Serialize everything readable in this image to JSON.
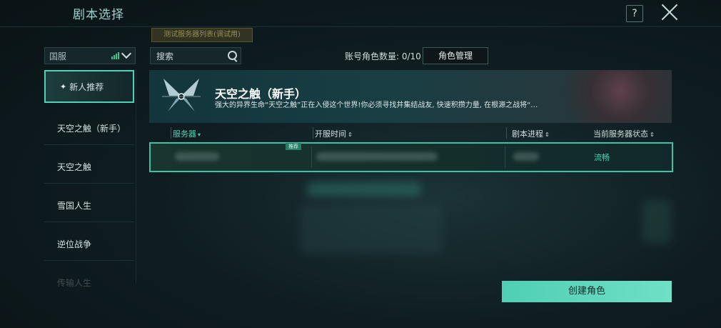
{
  "header": {
    "title": "剧本选择",
    "help_label": "?"
  },
  "test_badge": "测试服务器列表(调试用)",
  "region": {
    "label": "国服"
  },
  "search": {
    "placeholder": "搜索"
  },
  "account": {
    "label": "账号角色数量: 0/10",
    "role_manage_label": "角色管理"
  },
  "sidebar": {
    "items": [
      {
        "label": "新人推荐",
        "active": true
      },
      {
        "label": "天空之触（新手）"
      },
      {
        "label": "天空之触"
      },
      {
        "label": "雪国人生"
      },
      {
        "label": "逆位战争"
      },
      {
        "label": "传输人生"
      }
    ]
  },
  "banner": {
    "name": "天空之触（新手）",
    "description": "强大的异界生命“天空之触”正在入侵这个世界!你必须寻找并集结战友, 快速积攒力量, 在根源之战将“…"
  },
  "table": {
    "headers": {
      "server": "服务器",
      "open_time": "开服时间",
      "progress": "剧本进程",
      "status": "当前服务器状态"
    },
    "rows": [
      {
        "badge": "推荐",
        "status": "流畅"
      }
    ]
  },
  "create_button": "创建角色",
  "colors": {
    "accent": "#4fd2b6",
    "background": "#0f1d21"
  }
}
